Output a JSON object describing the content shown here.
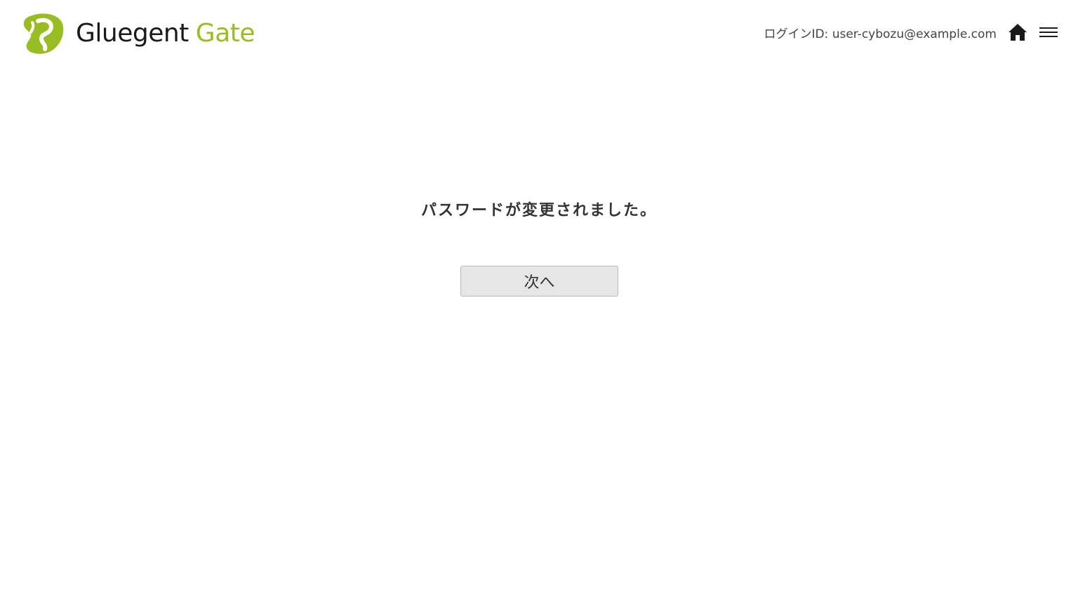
{
  "brand": {
    "name_part1": "Gluegent",
    "name_part2": "Gate",
    "color_dark": "#1a1a1a",
    "color_accent": "#97bd22"
  },
  "header": {
    "login_id_text": "ログインID: user-cybozu@example.com",
    "home_icon": "home-icon",
    "menu_icon": "hamburger-menu-icon"
  },
  "main": {
    "message": "パスワードが変更されました。",
    "next_button_label": "次へ"
  }
}
